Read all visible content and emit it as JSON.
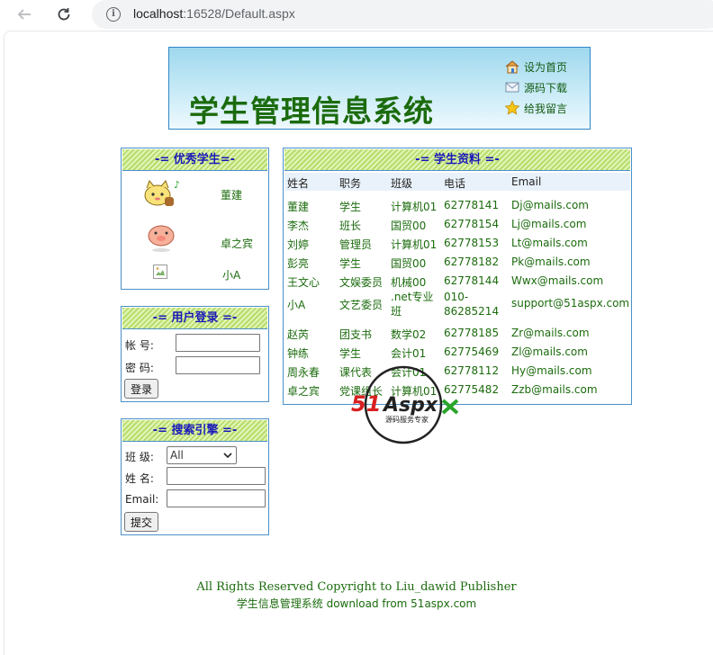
{
  "browser": {
    "url_host": "localhost",
    "url_rest": ":16528/Default.aspx"
  },
  "banner": {
    "title": "学生管理信息系统",
    "links": [
      "设为首页",
      "源码下载",
      "给我留言"
    ]
  },
  "excellent": {
    "heading": "-= 优秀学生=-",
    "students": [
      "董建",
      "卓之宾",
      "小A"
    ]
  },
  "login": {
    "heading": "-= 用户登录 =-",
    "account_label": "帐 号:",
    "password_label": "密 码:",
    "button": "登录"
  },
  "search": {
    "heading": "-= 搜索引擎 =-",
    "class_label": "班 级:",
    "class_selected": "All",
    "name_label": "姓 名:",
    "email_label": "Email:",
    "button": "提交"
  },
  "students": {
    "heading": "-= 学生资料 =-",
    "columns": [
      "姓名",
      "职务",
      "班级",
      "电话",
      "Email"
    ],
    "rows": [
      [
        "董建",
        "学生",
        "计算机01",
        "62778141",
        "Dj@mails.com"
      ],
      [
        "李杰",
        "班长",
        "国贸00",
        "62778154",
        "Lj@mails.com"
      ],
      [
        "刘婷",
        "管理员",
        "计算机01",
        "62778153",
        "Lt@mails.com"
      ],
      [
        "彭亮",
        "学生",
        "国贸00",
        "62778182",
        "Pk@mails.com"
      ],
      [
        "王文心",
        "文娱委员",
        "机械00",
        "62778144",
        "Wwx@mails.com"
      ],
      [
        "小A",
        "文艺委员",
        ".net专业班",
        "010-86285214",
        "support@51aspx.com"
      ],
      [
        "赵芮",
        "团支书",
        "数学02",
        "62778185",
        "Zr@mails.com"
      ],
      [
        "钟练",
        "学生",
        "会计01",
        "62775469",
        "Zl@mails.com"
      ],
      [
        "周永春",
        "课代表",
        "会计01",
        "62778112",
        "Hy@mails.com"
      ],
      [
        "卓之宾",
        "党课组长",
        "计算机01",
        "62775482",
        "Zzb@mails.com"
      ]
    ]
  },
  "watermark": {
    "brand": "51Aspx",
    "tagline": "源码服务专家"
  },
  "footer": {
    "line1": "All Rights Reserved    Copyright to Liu_dawid Publisher",
    "line2": "学生信息管理系统 download from 51aspx.com"
  }
}
